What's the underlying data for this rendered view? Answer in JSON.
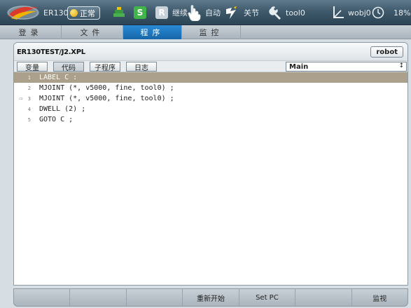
{
  "status": {
    "model": "ER130",
    "mode": "正常",
    "continue_label": "继续",
    "auto_label": "自动",
    "step_label": "关节",
    "tool": "tool0",
    "wobj": "wobj0",
    "speed_pct": "18%",
    "s_badge": "S",
    "r_badge": "R",
    "icons": [
      "logo-icon",
      "coordinate-icon",
      "hand-icon",
      "speed-icon",
      "tool-icon",
      "wobj-icon",
      "clock-icon"
    ]
  },
  "tabs": [
    {
      "label": "登录",
      "active": false
    },
    {
      "label": "文件",
      "active": false
    },
    {
      "label": "程序",
      "active": true
    },
    {
      "label": "监控",
      "active": false
    }
  ],
  "program": {
    "path": "ER130TEST/J2.XPL",
    "robot_button": "robot",
    "subtabs": [
      {
        "label": "变量",
        "active": false
      },
      {
        "label": "代码",
        "active": true
      },
      {
        "label": "子程序",
        "active": false
      },
      {
        "label": "日志",
        "active": false
      }
    ],
    "routine": "Main",
    "lines": [
      {
        "no": "1",
        "text": "LABEL C :",
        "selected": true,
        "pc": false
      },
      {
        "no": "2",
        "text": "MJOINT (*, v5000, fine, tool0) ;",
        "selected": false,
        "pc": false
      },
      {
        "no": "3",
        "text": "MJOINT (*, v5000, fine, tool0) ;",
        "selected": false,
        "pc": true
      },
      {
        "no": "4",
        "text": "DWELL (2) ;",
        "selected": false,
        "pc": false
      },
      {
        "no": "5",
        "text": "GOTO C ;",
        "selected": false,
        "pc": false
      }
    ]
  },
  "bottom_buttons": [
    "",
    "",
    "",
    "重新开始",
    "Set PC",
    "",
    "监视"
  ],
  "colors": {
    "accent": "#1a72bd",
    "selected_line": "#aaa08b",
    "status_bar": "#3f5a6c"
  }
}
